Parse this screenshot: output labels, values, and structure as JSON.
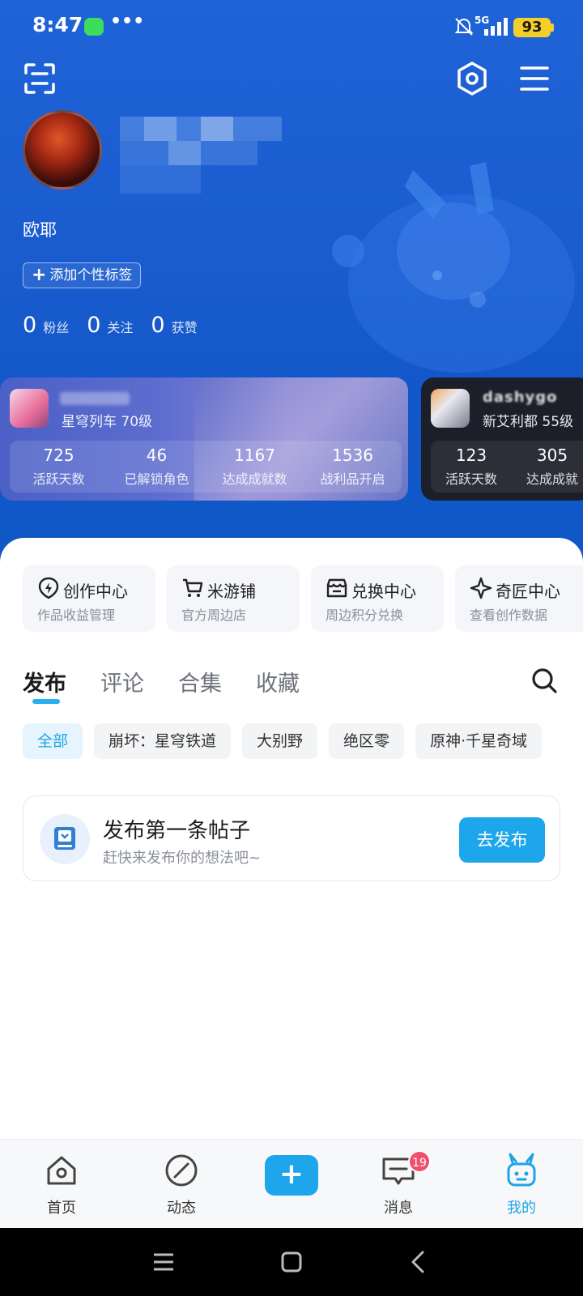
{
  "status_bar": {
    "time": "8:47",
    "dots": "•••",
    "network": "5G",
    "battery": "93"
  },
  "profile": {
    "username": "欧耶",
    "tag_button": "添加个性标签",
    "stats": [
      {
        "value": "0",
        "label": "粉丝"
      },
      {
        "value": "0",
        "label": "关注"
      },
      {
        "value": "0",
        "label": "获赞"
      }
    ]
  },
  "game_cards": [
    {
      "game_level": "星穹列车 70级",
      "stats": [
        {
          "value": "725",
          "label": "活跃天数"
        },
        {
          "value": "46",
          "label": "已解锁角色"
        },
        {
          "value": "1167",
          "label": "达成成就数"
        },
        {
          "value": "1536",
          "label": "战利品开启"
        }
      ]
    },
    {
      "player_name": "dashygo",
      "game_level": "新艾利都 55级",
      "stats": [
        {
          "value": "123",
          "label": "活跃天数"
        },
        {
          "value": "305",
          "label": "达成成就"
        }
      ]
    }
  ],
  "tools": [
    {
      "title": "创作中心",
      "subtitle": "作品收益管理",
      "icon": "lightning-shield-icon"
    },
    {
      "title": "米游铺",
      "subtitle": "官方周边店",
      "icon": "cart-icon"
    },
    {
      "title": "兑换中心",
      "subtitle": "周边积分兑换",
      "icon": "store-icon"
    },
    {
      "title": "奇匠中心",
      "subtitle": "查看创作数据",
      "icon": "sparkle-icon"
    }
  ],
  "tabs": [
    "发布",
    "评论",
    "合集",
    "收藏"
  ],
  "chips": [
    "全部",
    "崩坏：星穹铁道",
    "大别野",
    "绝区零",
    "原神·千星奇域"
  ],
  "empty_post": {
    "title": "发布第一条帖子",
    "subtitle": "赶快来发布你的想法吧~",
    "button": "去发布"
  },
  "bottom_nav": {
    "items": [
      "首页",
      "动态",
      "消息",
      "我的"
    ],
    "plus": "+",
    "message_badge": "19"
  },
  "colors": {
    "accent": "#1ea6ec",
    "header": "#1a5ccf",
    "badge": "#f0506e"
  }
}
